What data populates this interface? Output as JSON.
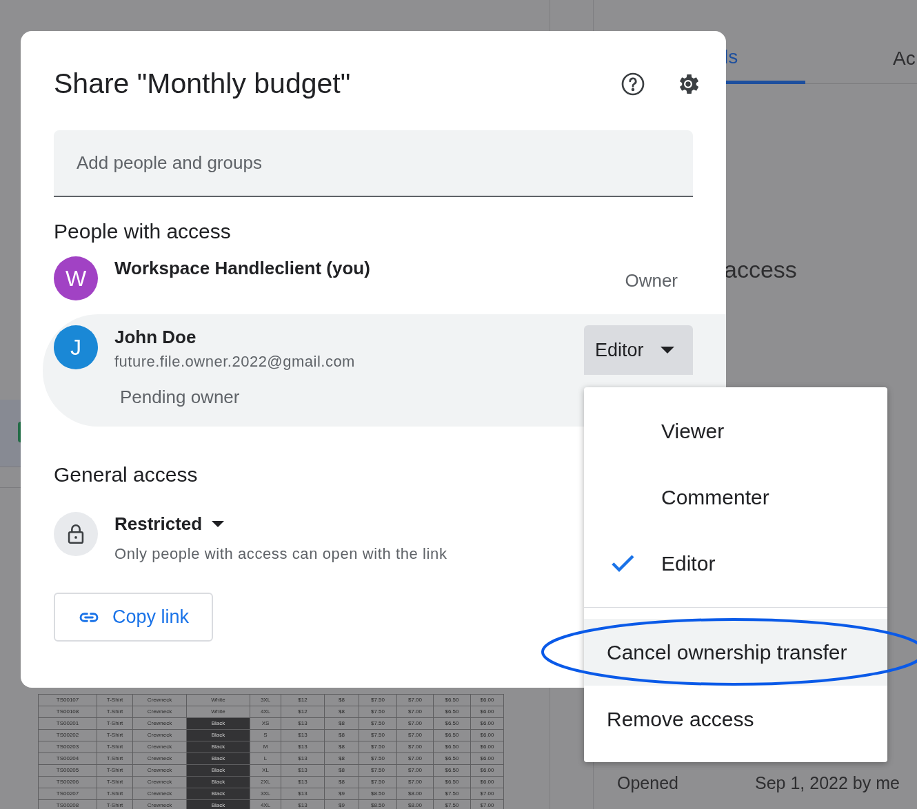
{
  "background": {
    "tabs": [
      {
        "label": "ls",
        "selected": true
      },
      {
        "label": "Ac",
        "selected": false
      }
    ],
    "section_heading": "access",
    "details": [
      {
        "label": "Opened",
        "value": "Sep 1, 2022 by me"
      }
    ],
    "sheet": {
      "rows": [
        {
          "cells": [
            "TS00107",
            "T-Shirt",
            "Crewneck",
            "White",
            "3XL",
            "$12",
            "$8",
            "$7.50",
            "$7.00",
            "$6.50",
            "$6.00"
          ],
          "shaded": false
        },
        {
          "cells": [
            "TS00108",
            "T-Shirt",
            "Crewneck",
            "White",
            "4XL",
            "$12",
            "$8",
            "$7.50",
            "$7.00",
            "$6.50",
            "$6.00"
          ],
          "shaded": false
        },
        {
          "cells": [
            "TS00201",
            "T-Shirt",
            "Crewneck",
            "Black",
            "XS",
            "$13",
            "$8",
            "$7.50",
            "$7.00",
            "$6.50",
            "$6.00"
          ],
          "shaded": true
        },
        {
          "cells": [
            "TS00202",
            "T-Shirt",
            "Crewneck",
            "Black",
            "S",
            "$13",
            "$8",
            "$7.50",
            "$7.00",
            "$6.50",
            "$6.00"
          ],
          "shaded": true
        },
        {
          "cells": [
            "TS00203",
            "T-Shirt",
            "Crewneck",
            "Black",
            "M",
            "$13",
            "$8",
            "$7.50",
            "$7.00",
            "$6.50",
            "$6.00"
          ],
          "shaded": true
        },
        {
          "cells": [
            "TS00204",
            "T-Shirt",
            "Crewneck",
            "Black",
            "L",
            "$13",
            "$8",
            "$7.50",
            "$7.00",
            "$6.50",
            "$6.00"
          ],
          "shaded": true
        },
        {
          "cells": [
            "TS00205",
            "T-Shirt",
            "Crewneck",
            "Black",
            "XL",
            "$13",
            "$8",
            "$7.50",
            "$7.00",
            "$6.50",
            "$6.00"
          ],
          "shaded": true
        },
        {
          "cells": [
            "TS00206",
            "T-Shirt",
            "Crewneck",
            "Black",
            "2XL",
            "$13",
            "$8",
            "$7.50",
            "$7.00",
            "$6.50",
            "$6.00"
          ],
          "shaded": true
        },
        {
          "cells": [
            "TS00207",
            "T-Shirt",
            "Crewneck",
            "Black",
            "3XL",
            "$13",
            "$9",
            "$8.50",
            "$8.00",
            "$7.50",
            "$7.00"
          ],
          "shaded": true
        },
        {
          "cells": [
            "TS00208",
            "T-Shirt",
            "Crewneck",
            "Black",
            "4XL",
            "$13",
            "$9",
            "$8.50",
            "$8.00",
            "$7.50",
            "$7.00"
          ],
          "shaded": true
        }
      ]
    }
  },
  "dialog": {
    "title": "Share \"Monthly budget\"",
    "search": {
      "placeholder": "Add people and groups"
    },
    "people_heading": "People with access",
    "people": [
      {
        "initial": "W",
        "color": "#a142c4",
        "name": "Workspace Handleclient (you)",
        "role": "Owner",
        "kind": "fixed",
        "selected": false
      },
      {
        "initial": "J",
        "color": "#1a88d6",
        "name": "John Doe",
        "email": "future.file.owner.2022@gmail.com",
        "note": "Pending owner",
        "role": "Editor",
        "kind": "dropdown",
        "selected": true
      }
    ],
    "general_heading": "General access",
    "access": {
      "label": "Restricted",
      "description": "Only people with access can open with the link"
    },
    "copy_link": "Copy link"
  },
  "role_menu": {
    "roles": [
      {
        "label": "Viewer",
        "checked": false
      },
      {
        "label": "Commenter",
        "checked": false
      },
      {
        "label": "Editor",
        "checked": true
      }
    ],
    "actions": [
      {
        "label": "Cancel ownership transfer",
        "selected": true
      },
      {
        "label": "Remove access",
        "selected": false
      }
    ]
  }
}
